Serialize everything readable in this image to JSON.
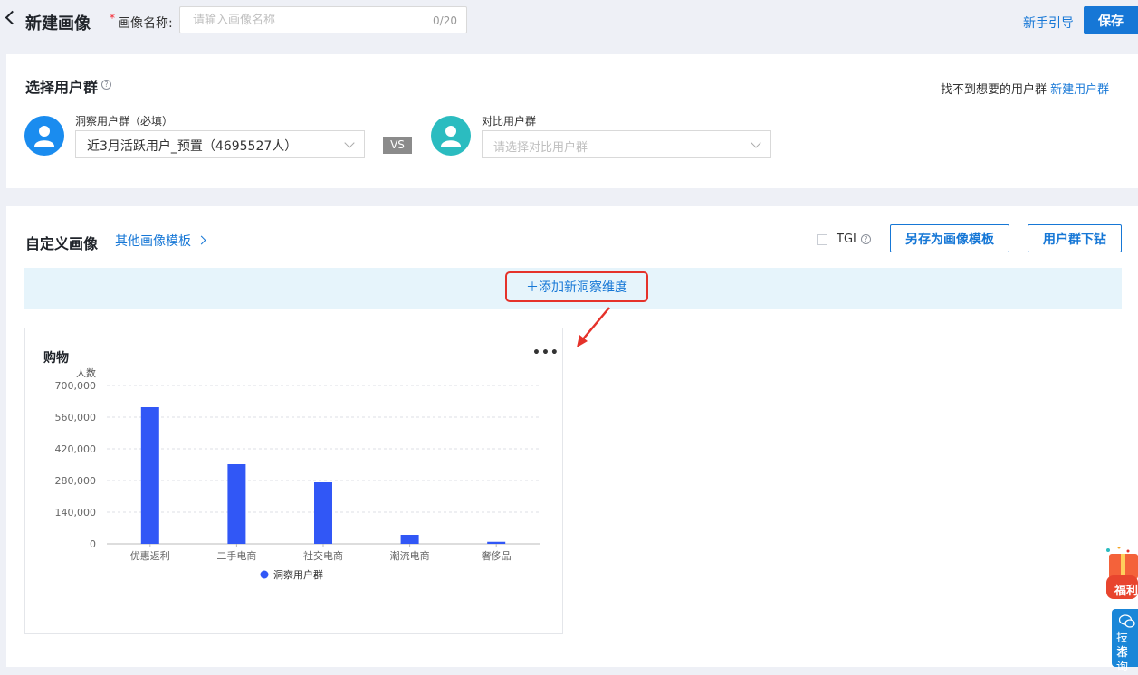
{
  "header": {
    "title": "新建画像",
    "required_mark": "*",
    "name_label": "画像名称:",
    "name_placeholder": "请输入画像名称",
    "name_counter": "0/20",
    "guide_link": "新手引导",
    "save_button": "保存"
  },
  "select_section": {
    "title": "选择用户群",
    "help_icon": "question-circle-icon",
    "not_found_text": "找不到想要的用户群",
    "new_group_link": "新建用户群",
    "insight_group": {
      "label": "洞察用户群（必填）",
      "value": "近3月活跃用户_预置（4695527人）",
      "avatar_color": "#1a8cef"
    },
    "vs_badge": "VS",
    "compare_group": {
      "label": "对比用户群",
      "placeholder": "请选择对比用户群",
      "avatar_color": "#2bbcc0"
    }
  },
  "custom_section": {
    "title": "自定义画像",
    "template_link": "其他画像模板",
    "tgi_label": "TGI",
    "save_template_button": "另存为画像模板",
    "drilldown_button": "用户群下钻",
    "add_dimension_button": "添加新洞察维度"
  },
  "chart_card": {
    "title": "购物",
    "more_icon": "more-dots-icon"
  },
  "chart_data": {
    "type": "bar",
    "categories": [
      "优惠返利",
      "二手电商",
      "社交电商",
      "潮流电商",
      "奢侈品"
    ],
    "series": [
      {
        "name": "洞察用户群",
        "values": [
          604000,
          352000,
          272000,
          40000,
          9000
        ],
        "color": "#3157f6"
      }
    ],
    "ylabel": "人数",
    "ylim": [
      0,
      700000
    ],
    "yticks": [
      "0",
      "140,000",
      "280,000",
      "420,000",
      "560,000",
      "700,000"
    ],
    "grid": true,
    "legend": "bottom-center"
  },
  "floats": {
    "gift_text": "福利",
    "support_text": [
      "技术",
      "咨询"
    ]
  },
  "colors": {
    "primary": "#1677d6",
    "highlight": "#e5322a",
    "bar": "#3157f6"
  }
}
